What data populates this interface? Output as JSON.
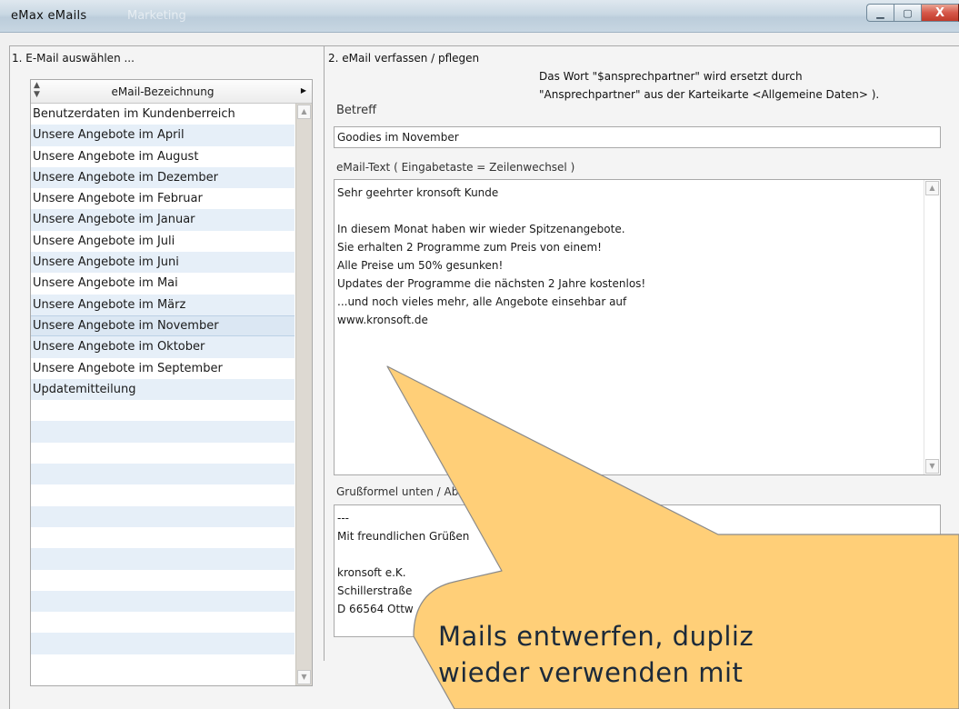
{
  "window": {
    "title": "eMax   eMails",
    "ghost_text": "Marketing",
    "buttons": {
      "minimize": "▁",
      "maximize": "▢",
      "close": "X"
    }
  },
  "left": {
    "section_title": "1. E-Mail auswählen ...",
    "column_header": "eMail-Bezeichnung",
    "items": [
      "Benutzerdaten im Kundenberreich",
      "Unsere Angebote im April",
      "Unsere Angebote im August",
      "Unsere Angebote im Dezember",
      "Unsere Angebote im Februar",
      "Unsere Angebote im Januar",
      "Unsere Angebote im Juli",
      "Unsere Angebote im Juni",
      "Unsere Angebote im Mai",
      "Unsere Angebote im März",
      "Unsere Angebote im November",
      "Unsere Angebote im Oktober",
      "Unsere Angebote im September",
      "Updatemitteilung"
    ],
    "selected_index": 10
  },
  "right": {
    "section_title": "2. eMail verfassen / pflegen",
    "hint_line1": "Das Wort  \"$ansprechpartner\" wird ersetzt durch",
    "hint_line2": "\"Ansprechpartner\" aus der Karteikarte <Allgemeine Daten> ).",
    "subject_label": "Betreff",
    "subject_value": "Goodies im November",
    "body_label": "eMail-Text ( Eingabetaste = Zeilenwechsel )",
    "body_lines": [
      "Sehr geehrter kronsoft Kunde",
      "",
      "In diesem Monat haben wir wieder Spitzenangebote.",
      "Sie erhalten 2 Programme zum Preis von einem!",
      "Alle Preise um 50% gesunken!",
      "Updates der Programme die nächsten 2 Jahre kostenlos!",
      "...und noch vieles mehr, alle Angebote einsehbar auf",
      "www.kronsoft.de"
    ],
    "footer_label": "Grußformel unten / Absende",
    "footer_lines": [
      "---",
      "Mit freundlichen Grüßen",
      "",
      "kronsoft e.K.",
      "Schillerstraße",
      "D 66564 Ottw"
    ]
  },
  "callout": {
    "line1": "Mails entwerfen, dupliz",
    "line2": "wieder verwenden mit"
  }
}
